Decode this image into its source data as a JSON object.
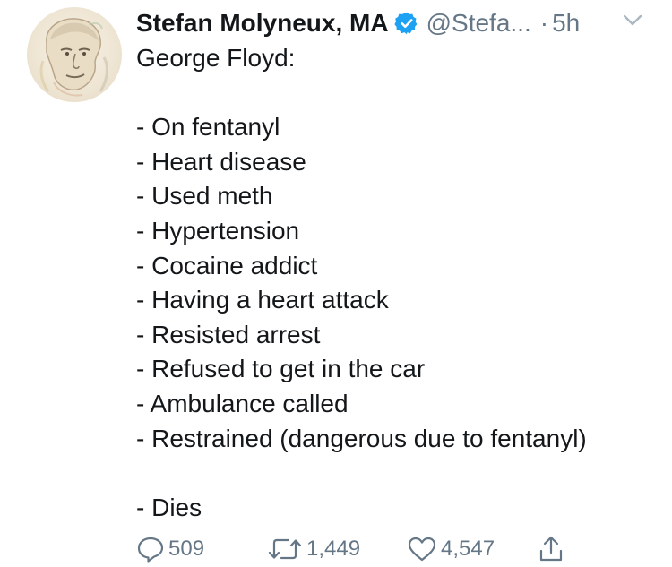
{
  "tweet": {
    "author_name": "Stefan Molyneux, MA",
    "handle": "@Stefa...",
    "separator": "·",
    "time": "5h",
    "lines": [
      "George Floyd:",
      "",
      "- On fentanyl",
      "- Heart disease",
      "- Used meth",
      "- Hypertension",
      "- Cocaine addict",
      "- Having a heart attack",
      "- Resisted arrest",
      "- Refused to get in the car",
      "- Ambulance called",
      "- Restrained (dangerous due to fentanyl)",
      "",
      "- Dies"
    ]
  },
  "actions": {
    "reply_count": "509",
    "retweet_count": "1,449",
    "like_count": "4,547"
  },
  "icons": {
    "verified": "verified-badge-icon",
    "caret": "chevron-down-icon",
    "reply": "reply-icon",
    "retweet": "retweet-icon",
    "like": "heart-icon",
    "share": "share-icon"
  },
  "colors": {
    "text": "#14171a",
    "secondary": "#657786",
    "verified": "#1da1f2"
  }
}
